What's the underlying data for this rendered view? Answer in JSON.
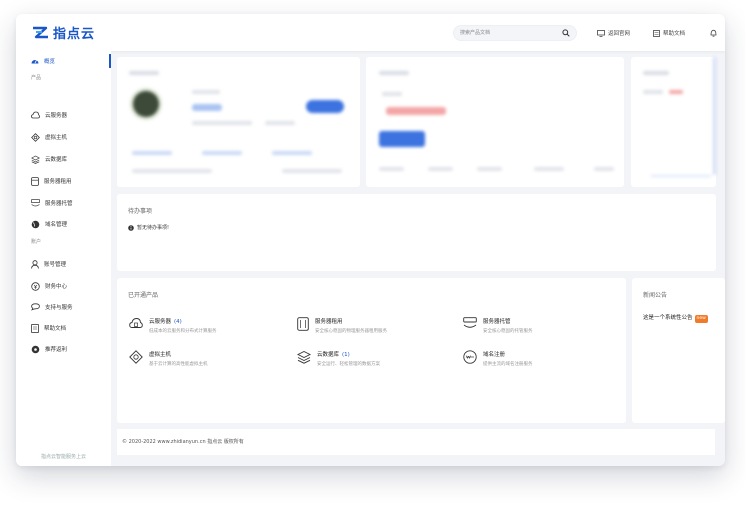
{
  "brand": {
    "name": "指点云",
    "color": "#1a56c8"
  },
  "header": {
    "search_placeholder": "搜索产品文档",
    "links": [
      {
        "label": "返回官网",
        "icon": "monitor-icon"
      },
      {
        "label": "帮助文档",
        "icon": "doc-icon"
      }
    ],
    "bell_icon": "bell-icon"
  },
  "sidebar": {
    "overview": "概览",
    "product_section": "产品",
    "product_items": [
      {
        "label": "云服务器",
        "icon": "cloud-server-icon"
      },
      {
        "label": "虚拟主机",
        "icon": "virtual-host-icon"
      },
      {
        "label": "云数据库",
        "icon": "database-icon"
      },
      {
        "label": "服务器租用",
        "icon": "server-rent-icon"
      },
      {
        "label": "服务器托管",
        "icon": "server-hosting-icon"
      },
      {
        "label": "域名管理",
        "icon": "globe-icon"
      }
    ],
    "account_section": "账户",
    "account_items": [
      {
        "label": "账号管理",
        "icon": "user-icon"
      },
      {
        "label": "财务中心",
        "icon": "money-icon"
      },
      {
        "label": "支持与服务",
        "icon": "chat-icon"
      },
      {
        "label": "帮助文档",
        "icon": "book-icon"
      },
      {
        "label": "推荐返利",
        "icon": "gift-icon"
      }
    ],
    "footer": "指点云智能服务上云"
  },
  "todo": {
    "title": "待办事项",
    "empty": "暂无待办事项!"
  },
  "products": {
    "title": "已开通产品",
    "items": [
      {
        "name": "云服务器",
        "count": "(4)",
        "desc": "低成本的云服务和分布式计算服务",
        "icon": "cloud-server-icon"
      },
      {
        "name": "服务器租用",
        "count": "",
        "desc": "安全核心稳固的物理服务器租用服务",
        "icon": "server-rent-icon"
      },
      {
        "name": "服务器托管",
        "count": "",
        "desc": "安全核心稳固的托管服务",
        "icon": "server-hosting-icon"
      },
      {
        "name": "虚拟主机",
        "count": "",
        "desc": "基于云计算的高性能虚拟主机",
        "icon": "virtual-host-icon"
      },
      {
        "name": "云数据库",
        "count": "(1)",
        "desc": "安全运行、轻松管理的数据方案",
        "icon": "database-icon"
      },
      {
        "name": "域名注册",
        "count": "",
        "desc": "提供主流的域名注册服务",
        "icon": "domain-icon"
      }
    ]
  },
  "news": {
    "title": "新闻公告",
    "item": "这是一个系统性公告",
    "badge": "new"
  },
  "footer": {
    "copyright": "© 2020-2022 www.zhidianyun.cn 指点云 版权所有"
  }
}
